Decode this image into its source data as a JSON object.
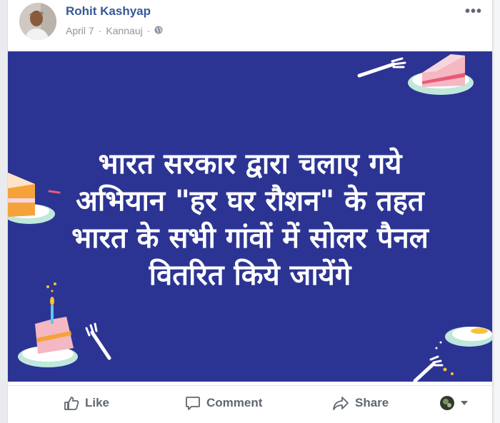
{
  "post": {
    "author": "Rohit Kashyap",
    "date": "April 7",
    "separator": "·",
    "location": "Kannauj",
    "privacy_icon": "globe-icon",
    "more_label": "•••"
  },
  "image": {
    "background_color": "#2c3493",
    "lines": [
      "भारत सरकार द्वारा चलाए गये",
      "अभियान \"हर घर रौशन\" के तहत",
      "भारत के सभी गांवों में सोलर पैनल",
      "वितरित किये जायेंगे"
    ]
  },
  "actions": {
    "like_label": "Like",
    "comment_label": "Comment",
    "share_label": "Share"
  }
}
